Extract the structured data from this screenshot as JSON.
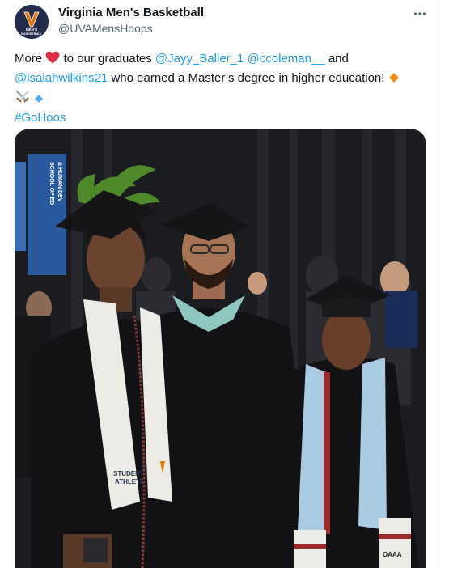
{
  "account": {
    "name": "Virginia Men's Basketball",
    "handle": "@UVAMensHoops",
    "avatar_icon": "uva-basketball-logo",
    "avatar_text_top": "MEN'S",
    "avatar_text_bottom": "BASKETBALL"
  },
  "menu": {
    "icon": "more-horizontal-icon"
  },
  "tweet": {
    "line1_pre": "More ",
    "line1_mid": " to our graduates ",
    "mention1": "@Jayy_Baller_1",
    "mention2": "@ccoleman__",
    "line1_post": " and",
    "mention3": "@isaiahwilkins21",
    "line2_post": " who earned a Master’s degree in higher education! ",
    "hashtag": "#GoHoos"
  },
  "photo": {
    "banner_text_1": "SCHOOL OF ED",
    "banner_text_2": "& HUMAN DEV",
    "stole_left_text_1": "STUDENT",
    "stole_left_text_2": "ATHLETE",
    "stole_right_text": "OAAA"
  },
  "colors": {
    "link": "#1d9bf0",
    "uva_navy": "#232d4b",
    "uva_orange": "#e57200",
    "stole_blue": "#a9cce3"
  }
}
